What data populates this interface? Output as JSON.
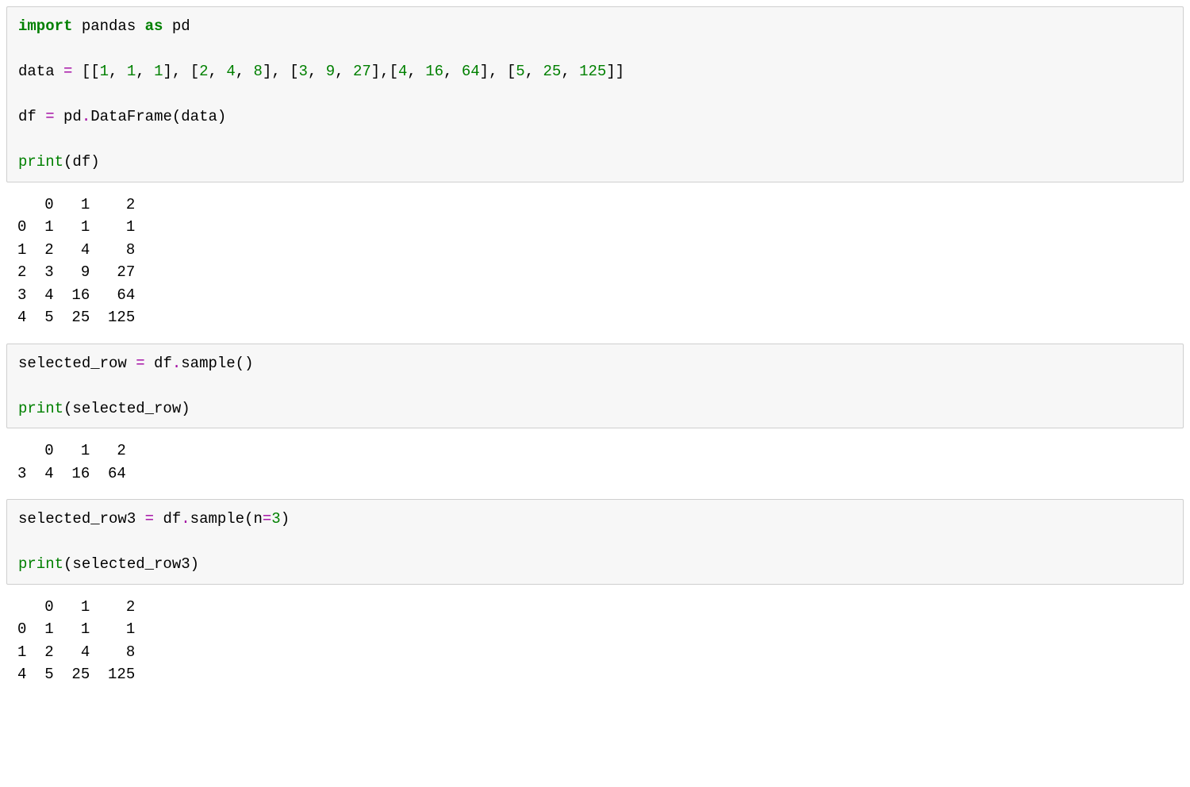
{
  "cells": [
    {
      "type": "code",
      "lines": [
        [
          {
            "cls": "kw-green-bold",
            "t": "import"
          },
          {
            "cls": "plain",
            "t": " pandas "
          },
          {
            "cls": "kw-green-bold",
            "t": "as"
          },
          {
            "cls": "plain",
            "t": " pd"
          }
        ],
        [],
        [
          {
            "cls": "plain",
            "t": "data "
          },
          {
            "cls": "kw-purple",
            "t": "="
          },
          {
            "cls": "plain",
            "t": " [["
          },
          {
            "cls": "num-green",
            "t": "1"
          },
          {
            "cls": "plain",
            "t": ", "
          },
          {
            "cls": "num-green",
            "t": "1"
          },
          {
            "cls": "plain",
            "t": ", "
          },
          {
            "cls": "num-green",
            "t": "1"
          },
          {
            "cls": "plain",
            "t": "], ["
          },
          {
            "cls": "num-green",
            "t": "2"
          },
          {
            "cls": "plain",
            "t": ", "
          },
          {
            "cls": "num-green",
            "t": "4"
          },
          {
            "cls": "plain",
            "t": ", "
          },
          {
            "cls": "num-green",
            "t": "8"
          },
          {
            "cls": "plain",
            "t": "], ["
          },
          {
            "cls": "num-green",
            "t": "3"
          },
          {
            "cls": "plain",
            "t": ", "
          },
          {
            "cls": "num-green",
            "t": "9"
          },
          {
            "cls": "plain",
            "t": ", "
          },
          {
            "cls": "num-green",
            "t": "27"
          },
          {
            "cls": "plain",
            "t": "],["
          },
          {
            "cls": "num-green",
            "t": "4"
          },
          {
            "cls": "plain",
            "t": ", "
          },
          {
            "cls": "num-green",
            "t": "16"
          },
          {
            "cls": "plain",
            "t": ", "
          },
          {
            "cls": "num-green",
            "t": "64"
          },
          {
            "cls": "plain",
            "t": "], ["
          },
          {
            "cls": "num-green",
            "t": "5"
          },
          {
            "cls": "plain",
            "t": ", "
          },
          {
            "cls": "num-green",
            "t": "25"
          },
          {
            "cls": "plain",
            "t": ", "
          },
          {
            "cls": "num-green",
            "t": "125"
          },
          {
            "cls": "plain",
            "t": "]]"
          }
        ],
        [],
        [
          {
            "cls": "plain",
            "t": "df "
          },
          {
            "cls": "kw-purple",
            "t": "="
          },
          {
            "cls": "plain",
            "t": " pd"
          },
          {
            "cls": "kw-purple",
            "t": "."
          },
          {
            "cls": "plain",
            "t": "DataFrame(data)"
          }
        ],
        [],
        [
          {
            "cls": "fn-green",
            "t": "print"
          },
          {
            "cls": "plain",
            "t": "(df)"
          }
        ]
      ],
      "output": "   0   1    2\n0  1   1    1\n1  2   4    8\n2  3   9   27\n3  4  16   64\n4  5  25  125"
    },
    {
      "type": "code",
      "lines": [
        [
          {
            "cls": "plain",
            "t": "selected_row "
          },
          {
            "cls": "kw-purple",
            "t": "="
          },
          {
            "cls": "plain",
            "t": " df"
          },
          {
            "cls": "kw-purple",
            "t": "."
          },
          {
            "cls": "plain",
            "t": "sample()"
          }
        ],
        [],
        [
          {
            "cls": "fn-green",
            "t": "print"
          },
          {
            "cls": "plain",
            "t": "(selected_row)"
          }
        ]
      ],
      "output": "   0   1   2\n3  4  16  64"
    },
    {
      "type": "code",
      "lines": [
        [
          {
            "cls": "plain",
            "t": "selected_row3 "
          },
          {
            "cls": "kw-purple",
            "t": "="
          },
          {
            "cls": "plain",
            "t": " df"
          },
          {
            "cls": "kw-purple",
            "t": "."
          },
          {
            "cls": "plain",
            "t": "sample(n"
          },
          {
            "cls": "kw-purple",
            "t": "="
          },
          {
            "cls": "num-green",
            "t": "3"
          },
          {
            "cls": "plain",
            "t": ")"
          }
        ],
        [],
        [
          {
            "cls": "fn-green",
            "t": "print"
          },
          {
            "cls": "plain",
            "t": "(selected_row3)"
          }
        ]
      ],
      "output": "   0   1    2\n0  1   1    1\n1  2   4    8\n4  5  25  125"
    }
  ]
}
